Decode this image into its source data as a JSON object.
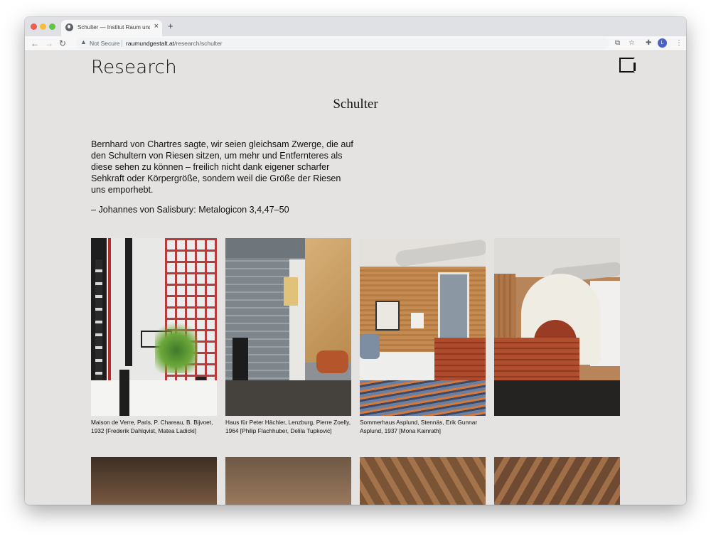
{
  "browser": {
    "tab_title": "Schulter — Institut Raum und Gestaltung",
    "tab_close": "×",
    "new_tab": "+",
    "security_icon": "warning-triangle-icon",
    "security_label": "Not Secure",
    "url_host": "raumundgestalt.at",
    "url_path": "/research/schulter",
    "avatar_initial": "L",
    "nav": {
      "back": "←",
      "forward": "→",
      "reload": "↻"
    },
    "icons": {
      "translate": "⧉",
      "bookmark": "☆",
      "extensions": "✚",
      "menu": "⋮"
    }
  },
  "header": {
    "site_name": "Research"
  },
  "page": {
    "title": "Schulter",
    "quote": "Bernhard von Chartres sagte, wir seien gleichsam Zwerge, die auf den Schultern von Riesen sitzen, um mehr und Entfernteres als diese sehen zu können – freilich nicht dank eigener scharfer Sehkraft oder Körpergröße, sondern weil die Größe der Riesen uns emporhebt.",
    "citation": "– Johannes von Salisbury: Metalogicon 3,4,47–50"
  },
  "gallery": [
    {
      "caption": "Maison de Verre, Paris, P. Chareau, B. Bijvoet, 1932 [Frederik Dahlqvist, Matea Ladicki]"
    },
    {
      "caption": "Haus für Peter Hächler, Lenzburg, Pierre Zoelly, 1964 [Philip Flachhuber, Delila Tupković]"
    },
    {
      "caption": "Sommerhaus Asplund, Stennäs, Erik Gunnar Asplund, 1937 [Mona Kainrath]"
    },
    {
      "caption": ""
    }
  ]
}
